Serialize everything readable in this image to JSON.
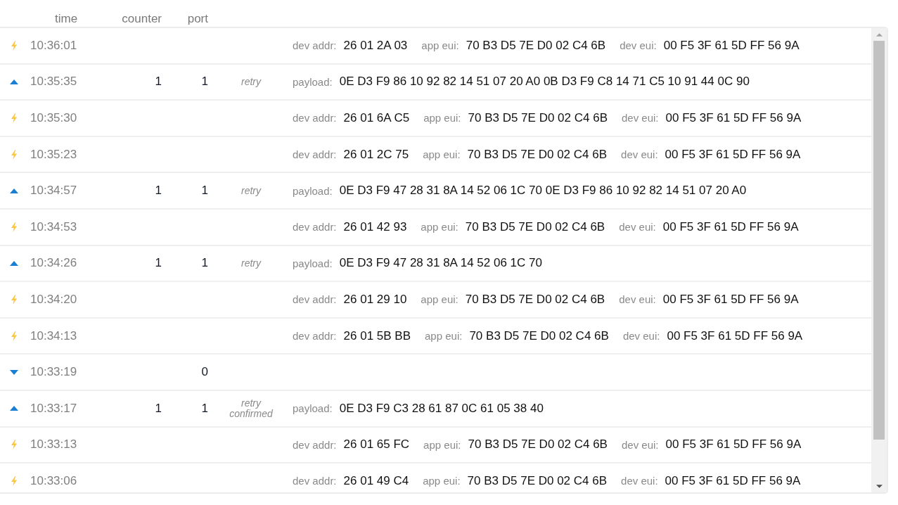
{
  "header": {
    "columns": [
      "time",
      "counter",
      "port"
    ]
  },
  "rows": [
    {
      "kind": "join",
      "time": "10:36:01",
      "fields": [
        {
          "label": "dev addr:",
          "value": "26 01 2A 03"
        },
        {
          "label": "app eui:",
          "value": "70 B3 D5 7E D0 02 C4 6B"
        },
        {
          "label": "dev eui:",
          "value": "00 F5 3F 61 5D FF 56 9A"
        }
      ]
    },
    {
      "kind": "uplink",
      "time": "10:35:35",
      "counter": "1",
      "port": "1",
      "flags": [
        "retry"
      ],
      "fields": [
        {
          "label": "payload:",
          "value": "0E D3 F9 86 10 92 82 14 51 07 20 A0 0B D3 F9 C8 14 71 C5 10 91 44 0C 90"
        }
      ]
    },
    {
      "kind": "join",
      "time": "10:35:30",
      "fields": [
        {
          "label": "dev addr:",
          "value": "26 01 6A C5"
        },
        {
          "label": "app eui:",
          "value": "70 B3 D5 7E D0 02 C4 6B"
        },
        {
          "label": "dev eui:",
          "value": "00 F5 3F 61 5D FF 56 9A"
        }
      ]
    },
    {
      "kind": "join",
      "time": "10:35:23",
      "fields": [
        {
          "label": "dev addr:",
          "value": "26 01 2C 75"
        },
        {
          "label": "app eui:",
          "value": "70 B3 D5 7E D0 02 C4 6B"
        },
        {
          "label": "dev eui:",
          "value": "00 F5 3F 61 5D FF 56 9A"
        }
      ]
    },
    {
      "kind": "uplink",
      "time": "10:34:57",
      "counter": "1",
      "port": "1",
      "flags": [
        "retry"
      ],
      "fields": [
        {
          "label": "payload:",
          "value": "0E D3 F9 47 28 31 8A 14 52 06 1C 70 0E D3 F9 86 10 92 82 14 51 07 20 A0"
        }
      ]
    },
    {
      "kind": "join",
      "time": "10:34:53",
      "fields": [
        {
          "label": "dev addr:",
          "value": "26 01 42 93"
        },
        {
          "label": "app eui:",
          "value": "70 B3 D5 7E D0 02 C4 6B"
        },
        {
          "label": "dev eui:",
          "value": "00 F5 3F 61 5D FF 56 9A"
        }
      ]
    },
    {
      "kind": "uplink",
      "time": "10:34:26",
      "counter": "1",
      "port": "1",
      "flags": [
        "retry"
      ],
      "fields": [
        {
          "label": "payload:",
          "value": "0E D3 F9 47 28 31 8A 14 52 06 1C 70"
        }
      ]
    },
    {
      "kind": "join",
      "time": "10:34:20",
      "fields": [
        {
          "label": "dev addr:",
          "value": "26 01 29 10"
        },
        {
          "label": "app eui:",
          "value": "70 B3 D5 7E D0 02 C4 6B"
        },
        {
          "label": "dev eui:",
          "value": "00 F5 3F 61 5D FF 56 9A"
        }
      ]
    },
    {
      "kind": "join",
      "time": "10:34:13",
      "fields": [
        {
          "label": "dev addr:",
          "value": "26 01 5B BB"
        },
        {
          "label": "app eui:",
          "value": "70 B3 D5 7E D0 02 C4 6B"
        },
        {
          "label": "dev eui:",
          "value": "00 F5 3F 61 5D FF 56 9A"
        }
      ]
    },
    {
      "kind": "downlink",
      "time": "10:33:19",
      "port": "0"
    },
    {
      "kind": "uplink",
      "time": "10:33:17",
      "counter": "1",
      "port": "1",
      "flags": [
        "retry",
        "confirmed"
      ],
      "fields": [
        {
          "label": "payload:",
          "value": "0E D3 F9 C3 28 61 87 0C 61 05 38 40"
        }
      ]
    },
    {
      "kind": "join",
      "time": "10:33:13",
      "fields": [
        {
          "label": "dev addr:",
          "value": "26 01 65 FC"
        },
        {
          "label": "app eui:",
          "value": "70 B3 D5 7E D0 02 C4 6B"
        },
        {
          "label": "dev eui:",
          "value": "00 F5 3F 61 5D FF 56 9A"
        }
      ]
    },
    {
      "kind": "join",
      "time": "10:33:06",
      "fields": [
        {
          "label": "dev addr:",
          "value": "26 01 49 C4"
        },
        {
          "label": "app eui:",
          "value": "70 B3 D5 7E D0 02 C4 6B"
        },
        {
          "label": "dev eui:",
          "value": "00 F5 3F 61 5D FF 56 9A"
        }
      ]
    }
  ]
}
